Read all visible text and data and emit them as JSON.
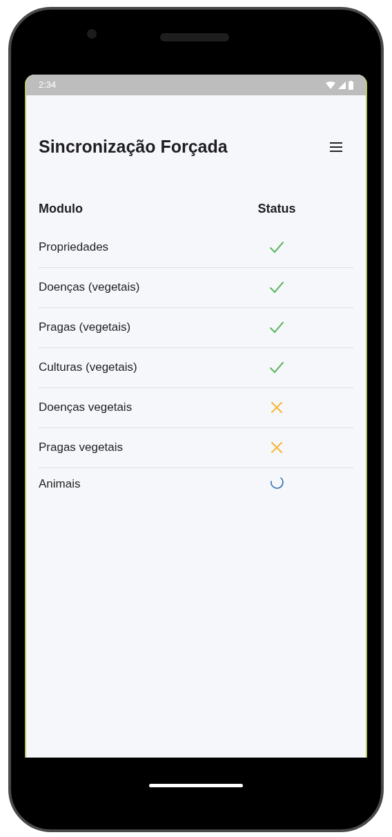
{
  "status_bar": {
    "time": "2:34"
  },
  "app_bar": {
    "title": "Sincronização Forçada"
  },
  "table": {
    "columns": [
      "Modulo",
      "Status"
    ],
    "rows": [
      {
        "module": "Propriedades",
        "kind": "done"
      },
      {
        "module": "Doenças (vegetais)",
        "kind": "done"
      },
      {
        "module": "Pragas (vegetais)",
        "kind": "done"
      },
      {
        "module": "Culturas (vegetais)",
        "kind": "done"
      },
      {
        "module": "Doenças vegetais",
        "kind": "failed"
      },
      {
        "module": "Pragas vegetais",
        "kind": "failed"
      },
      {
        "module": "Animais",
        "kind": "loading"
      }
    ]
  }
}
